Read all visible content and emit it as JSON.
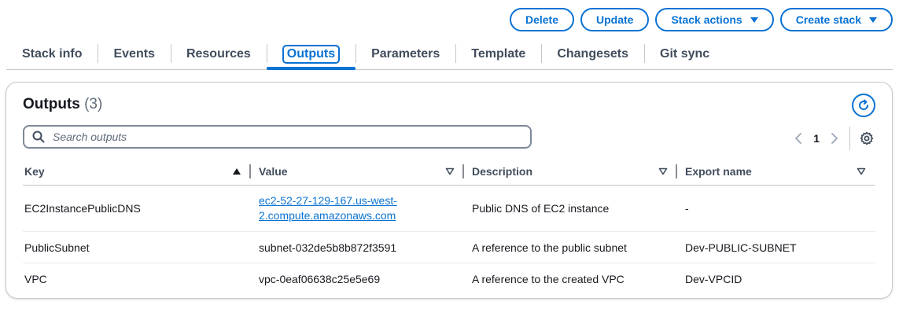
{
  "actions": {
    "delete_label": "Delete",
    "update_label": "Update",
    "stack_actions_label": "Stack actions",
    "create_stack_label": "Create stack"
  },
  "tabs": [
    {
      "label": "Stack info"
    },
    {
      "label": "Events"
    },
    {
      "label": "Resources"
    },
    {
      "label": "Outputs",
      "active": true
    },
    {
      "label": "Parameters"
    },
    {
      "label": "Template"
    },
    {
      "label": "Changesets"
    },
    {
      "label": "Git sync"
    }
  ],
  "panel": {
    "title": "Outputs",
    "count": "(3)",
    "search_placeholder": "Search outputs",
    "current_page": "1"
  },
  "table": {
    "headers": [
      "Key",
      "Value",
      "Description",
      "Export name"
    ],
    "rows": [
      {
        "key": "EC2InstancePublicDNS",
        "value_line1": "ec2-52-27-129-167.us-west-",
        "value_line2": "2.compute.amazonaws.com",
        "description": "Public DNS of EC2 instance",
        "export": "-"
      },
      {
        "key": "PublicSubnet",
        "value": "subnet-032de5b8b872f3591",
        "description": "A reference to the public subnet",
        "export": "Dev-PUBLIC-SUBNET"
      },
      {
        "key": "VPC",
        "value": "vpc-0eaf06638c25e5e69",
        "description": "A reference to the created VPC",
        "export": "Dev-VPCID"
      }
    ]
  },
  "colors": {
    "accent": "#0972d3",
    "text": "#16191f",
    "muted": "#414d5c",
    "border": "#c6c6cd"
  },
  "icons": [
    "caret-down-icon",
    "refresh-icon",
    "search-icon",
    "chevron-left-icon",
    "chevron-right-icon",
    "settings-icon",
    "sort-ascending-icon",
    "sort-descending-icon"
  ]
}
